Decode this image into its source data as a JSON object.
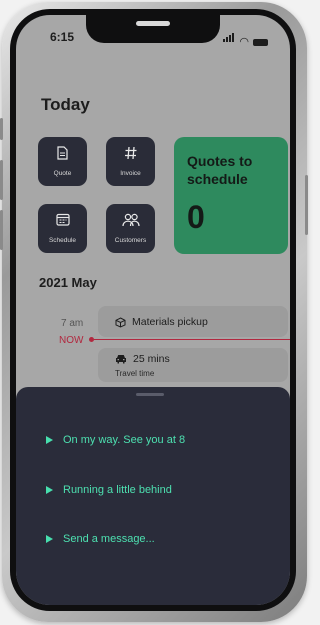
{
  "status_bar": {
    "time": "6:15"
  },
  "header": {
    "title": "Today"
  },
  "tiles": [
    {
      "label": "Quote",
      "icon": "document-icon"
    },
    {
      "label": "Invoice",
      "icon": "hash-icon"
    },
    {
      "label": "Schedule",
      "icon": "calendar-icon"
    },
    {
      "label": "Customers",
      "icon": "users-icon"
    }
  ],
  "quotes_card": {
    "title": "Quotes to schedule",
    "count": "0"
  },
  "calendar": {
    "month": "2021 May",
    "time_label": "7 am",
    "now_label": "NOW",
    "events": [
      {
        "title": "Materials pickup",
        "icon": "box-icon"
      },
      {
        "title": "25 mins",
        "subtitle": "Travel time",
        "icon": "car-icon"
      }
    ]
  },
  "sheet": {
    "options": [
      {
        "label": "On my way. See you at 8"
      },
      {
        "label": "Running a little behind"
      },
      {
        "label": "Send a message..."
      }
    ]
  },
  "colors": {
    "accent": "#4de0b0",
    "card_green": "#2e8a5e",
    "tile_dark": "#2a2c38",
    "now_red": "#b1283f",
    "sheet_bg": "#2a2c3a"
  }
}
